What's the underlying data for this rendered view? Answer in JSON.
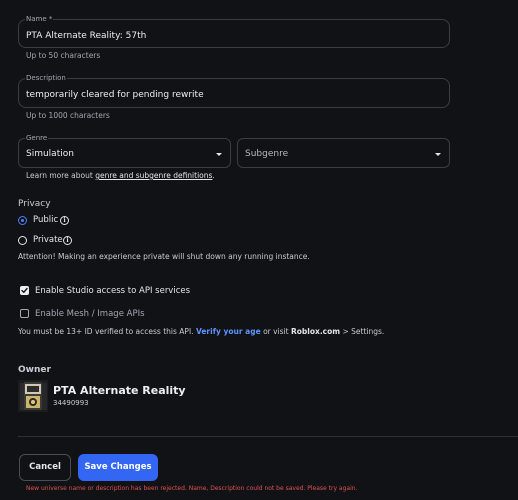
{
  "name_field": {
    "label": "Name *",
    "value": "PTA Alternate Reality: 57th",
    "helper": "Up to 50 characters"
  },
  "description_field": {
    "label": "Description",
    "value": "temporarily cleared for pending rewrite",
    "helper": "Up to 1000 characters"
  },
  "genre": {
    "label": "Genre",
    "selected": "Simulation",
    "subgenre_placeholder": "Subgenre",
    "learn_prefix": "Learn more about",
    "learn_link": "genre and subgenre definitions",
    "learn_suffix": "."
  },
  "privacy": {
    "heading": "Privacy",
    "public_label": "Public",
    "private_label": "Private",
    "selected": "Public",
    "warning": "Attention! Making an experience private will shut down any running instance."
  },
  "studio_access": {
    "label": "Enable Studio access to API services",
    "checked": true
  },
  "mesh_apis": {
    "label": "Enable Mesh / Image APIs",
    "checked": false,
    "note_prefix": "You must be 13+ ID verified to access this API.",
    "note_link": "Verify your age",
    "note_mid": "or visit",
    "note_site": "Roblox.com",
    "note_suffix": "> Settings."
  },
  "owner": {
    "heading": "Owner",
    "name": "PTA Alternate Reality",
    "id": "34490993"
  },
  "actions": {
    "cancel_label": "Cancel",
    "save_label": "Save Changes",
    "error_message": "New universe name or description has been rejected. Name, Description could not be saved. Please try again."
  },
  "colors": {
    "background": "#111216",
    "accent": "#3367f3",
    "link": "#5e93ff",
    "error": "#e0534d"
  }
}
